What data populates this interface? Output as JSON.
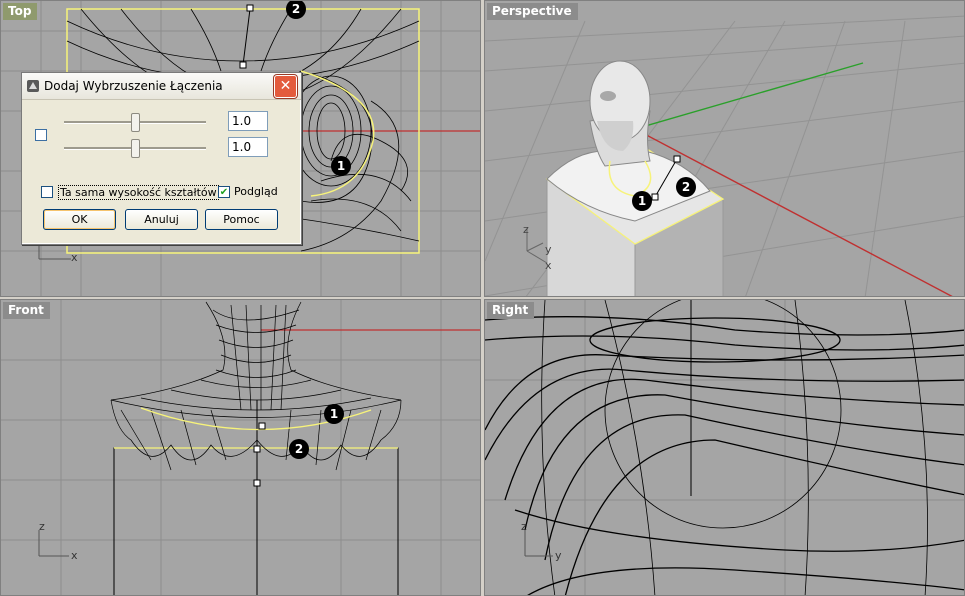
{
  "viewports": {
    "top": {
      "title": "Top"
    },
    "perspective": {
      "title": "Perspective"
    },
    "front": {
      "title": "Front"
    },
    "right": {
      "title": "Right"
    }
  },
  "axes": {
    "x": "x",
    "y": "y",
    "z": "z"
  },
  "markers": {
    "one": "1",
    "two": "2"
  },
  "dialog": {
    "title": "Dodaj Wybrzuszenie Łączenia",
    "value1": "1.0",
    "value2": "1.0",
    "slider1_level": 0.5,
    "slider2_level": 0.5,
    "same_height_label": "Ta sama wysokość kształtów",
    "same_height_checked": false,
    "preview_label": "Podgląd",
    "preview_checked": true,
    "ok": "OK",
    "cancel": "Anuluj",
    "help": "Pomoc"
  },
  "colors": {
    "viewport_bg": "#a5a5a5",
    "active_title": "#8f9a6d",
    "selection": "#f7f37a",
    "x_axis": "#c03030",
    "y_axis": "#2aa02a"
  }
}
